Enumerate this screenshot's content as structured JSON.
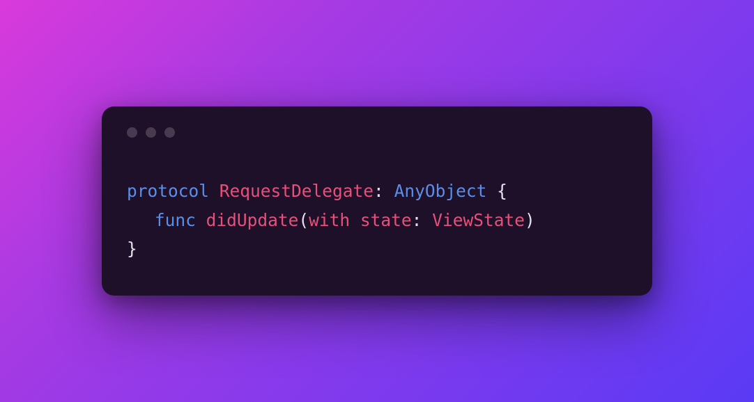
{
  "code": {
    "line1": {
      "keyword": "protocol",
      "typename": "RequestDelegate",
      "colon": ":",
      "superclass": "AnyObject",
      "openBrace": "{"
    },
    "line2": {
      "keyword": "func",
      "funcName": "didUpdate",
      "openParen": "(",
      "extLabel": "with",
      "intLabel": "state",
      "colon": ":",
      "paramType": "ViewState",
      "closeParen": ")"
    },
    "line3": {
      "closeBrace": "}"
    }
  }
}
